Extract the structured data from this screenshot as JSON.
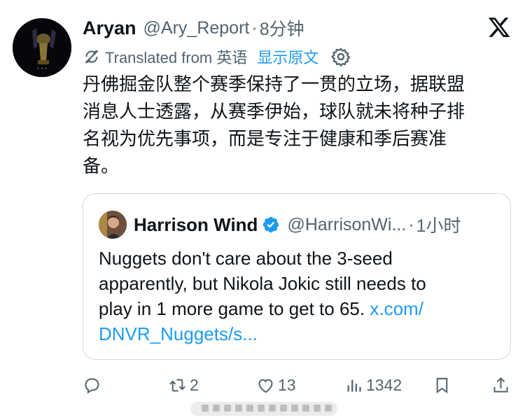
{
  "tweet": {
    "author_name": "Aryan",
    "author_handle": "@Ary_Report",
    "separator": "·",
    "time": "8分钟",
    "translated_label": "Translated from 英语",
    "show_original": "显示原文",
    "body_lines": [
      "丹佛掘金队整个赛季保持了一贯的立场，据联盟",
      "消息人士透露，从赛季伊始，球队就未将种子排",
      "名视为优先事项，而是专注于健康和季后赛准",
      "备。"
    ]
  },
  "quote": {
    "author_name": "Harrison Wind",
    "author_handle": "@HarrisonWi...",
    "separator": "·",
    "time": "1小时",
    "text_lines": [
      "Nuggets don't care about the 3-seed",
      "apparently, but Nikola Jokic still needs to",
      "play in 1 more game to get to 65."
    ],
    "link_part1": "x.com/",
    "link_part2": "DNVR_Nuggets/s..."
  },
  "actions": {
    "reply_count": "",
    "retweet_count": "2",
    "like_count": "13",
    "view_count": "1342"
  },
  "icons": {
    "x_logo": "x-logo-icon",
    "translate": "translate-icon",
    "settings": "gear-icon",
    "verified": "verified-badge-icon",
    "reply": "reply-icon",
    "retweet": "retweet-icon",
    "like": "heart-icon",
    "views": "views-icon",
    "bookmark": "bookmark-icon",
    "share": "share-icon"
  },
  "colors": {
    "text_primary": "#0f1419",
    "text_secondary": "#536471",
    "link": "#1d9bf0",
    "border": "#cfd9de"
  }
}
